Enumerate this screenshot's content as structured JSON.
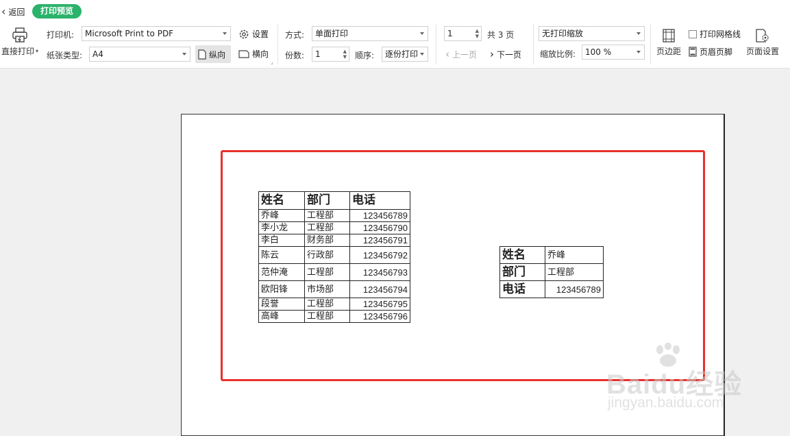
{
  "header": {
    "back_label": "返回",
    "badge": "打印预览"
  },
  "printer_group": {
    "direct_print": "直接打印",
    "printer_label": "打印机:",
    "printer_value": "Microsoft Print to PDF",
    "settings": "设置",
    "paper_label": "纸张类型:",
    "paper_value": "A4",
    "portrait": "纵向",
    "landscape": "横向"
  },
  "mode_group": {
    "mode_label": "方式:",
    "mode_value": "单面打印",
    "copies_label": "份数:",
    "copies_value": "1",
    "order_label": "顺序:",
    "order_value": "逐份打印"
  },
  "page_group": {
    "page_value": "1",
    "total_pages": "共 3 页",
    "prev": "上一页",
    "next": "下一页"
  },
  "scale_group": {
    "scale_mode": "无打印缩放",
    "zoom_label": "缩放比例:",
    "zoom_value": "100 %"
  },
  "layout_group": {
    "margins": "页边距",
    "gridlines": "打印网格线",
    "header_footer": "页眉页脚",
    "page_setup": "页面设置"
  },
  "preview": {
    "table1": {
      "headers": [
        "姓名",
        "部门",
        "电话"
      ],
      "rows": [
        [
          "乔峰",
          "工程部",
          "123456789"
        ],
        [
          "李小龙",
          "工程部",
          "123456790"
        ],
        [
          "李白",
          "财务部",
          "123456791"
        ],
        [
          "陈云",
          "行政部",
          "123456792"
        ],
        [
          "范仲淹",
          "工程部",
          "123456793"
        ],
        [
          "欧阳锋",
          "市场部",
          "123456794"
        ],
        [
          "段誉",
          "工程部",
          "123456795"
        ],
        [
          "高峰",
          "工程部",
          "123456796"
        ]
      ]
    },
    "table2": {
      "rows": [
        [
          "姓名",
          "乔峰"
        ],
        [
          "部门",
          "工程部"
        ],
        [
          "电话",
          "123456789"
        ]
      ]
    }
  },
  "watermark": {
    "brand": "Baidu经验",
    "url": "jingyan.baidu.com"
  },
  "colors": {
    "accent": "#2cb36b",
    "highlight": "#e8302a"
  }
}
